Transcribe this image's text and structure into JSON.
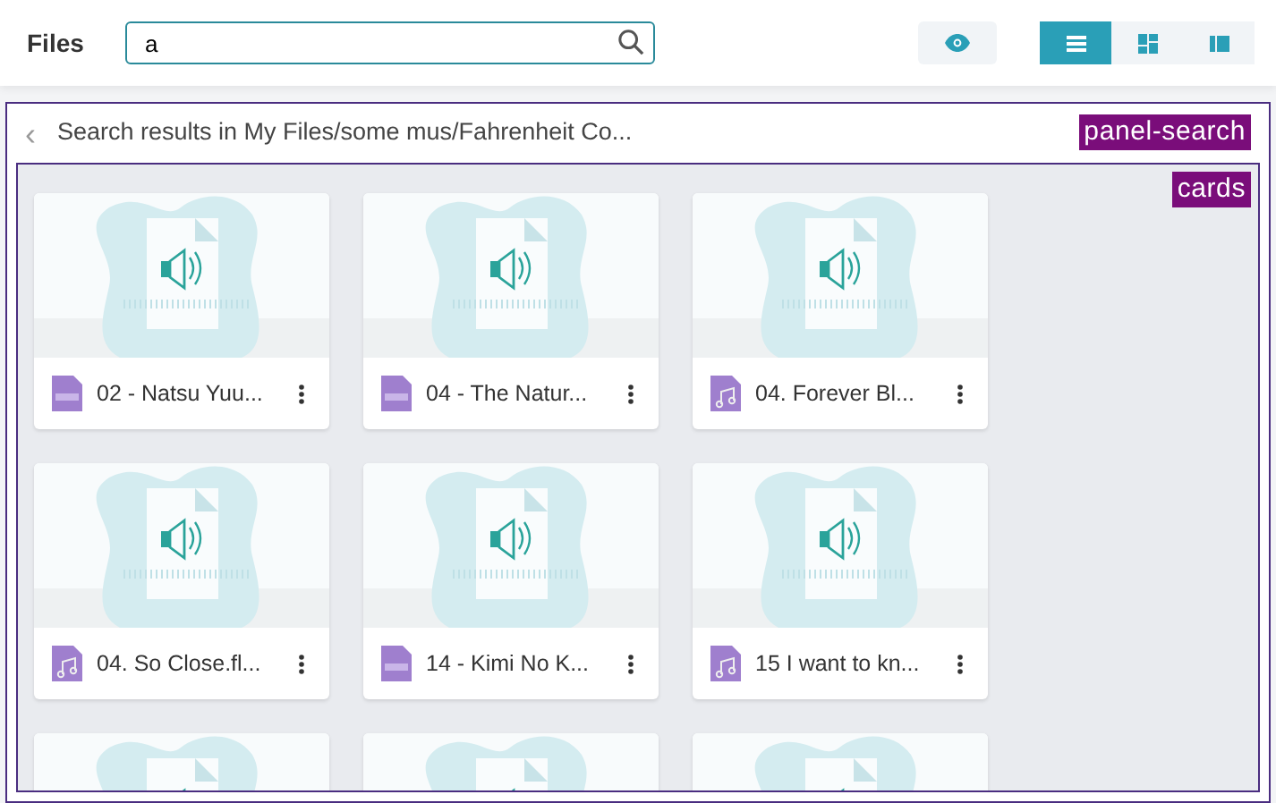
{
  "header": {
    "title": "Files",
    "search": {
      "value": "a"
    },
    "preview_toggle": {
      "on": false
    },
    "view_modes": [
      {
        "kind": "list",
        "selected": true
      },
      {
        "kind": "grid",
        "selected": false
      },
      {
        "kind": "columns",
        "selected": false
      }
    ]
  },
  "panel": {
    "back": "‹",
    "title": "Search results in My Files/some mus/Fahrenheit Co...",
    "debug_label": "panel-search"
  },
  "cards": {
    "debug_label": "cards",
    "items": [
      {
        "kind": "mp3",
        "name": "02 - Natsu Yuu..."
      },
      {
        "kind": "mp3",
        "name": "04 - The Natur..."
      },
      {
        "kind": "music",
        "name": "04. Forever Bl..."
      },
      {
        "kind": "music",
        "name": "04. So Close.fl..."
      },
      {
        "kind": "mp3",
        "name": "14 - Kimi No K..."
      },
      {
        "kind": "music",
        "name": "15 I want to kn..."
      },
      {
        "kind": "partial"
      },
      {
        "kind": "partial"
      },
      {
        "kind": "partial"
      }
    ]
  }
}
